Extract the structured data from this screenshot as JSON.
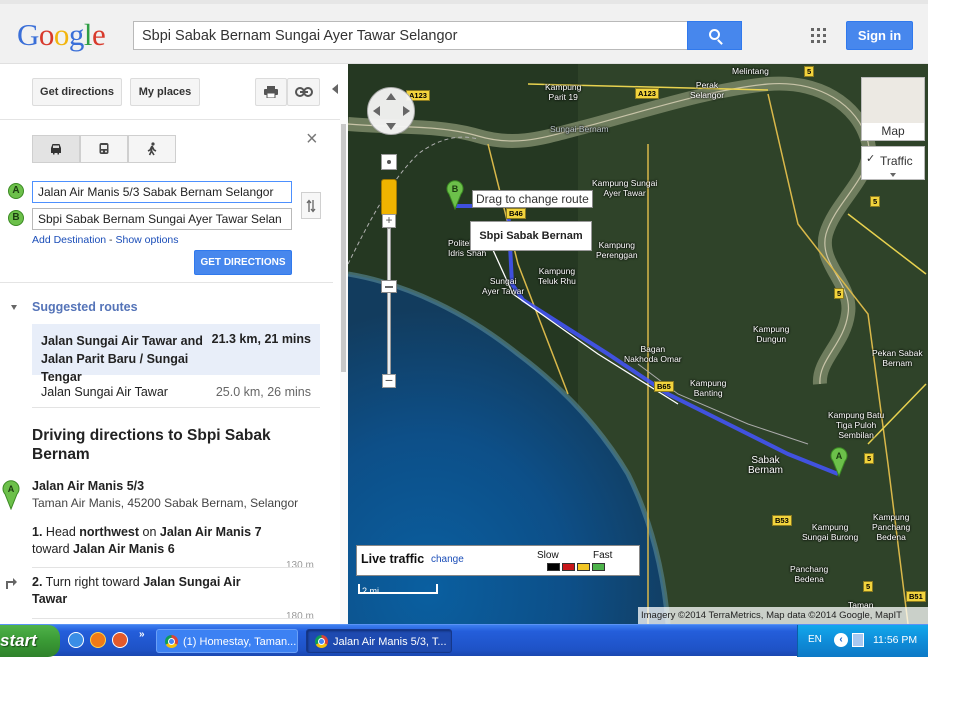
{
  "header": {
    "logo": "Google",
    "search_value": "Sbpi Sabak Bernam Sungai Ayer Tawar Selangor",
    "signin_label": "Sign in"
  },
  "panel": {
    "get_directions_tab": "Get directions",
    "my_places_tab": "My places",
    "origin_marker": "A",
    "dest_marker": "B",
    "origin_value": "Jalan Air Manis 5/3 Sabak Bernam Selangor",
    "destination_value": "Sbpi Sabak Bernam Sungai Ayer Tawar Selan",
    "add_destination": "Add Destination",
    "separator": " - ",
    "show_options": "Show options",
    "get_directions_button": "GET DIRECTIONS",
    "suggested_routes_title": "Suggested routes",
    "routes": [
      {
        "name": "Jalan Sungai Air Tawar and Jalan Parit Baru / Sungai Tengar",
        "distance": "21.3 km, 21 mins"
      },
      {
        "name": "Jalan Sungai Air Tawar",
        "distance": "25.0 km, 26 mins"
      }
    ],
    "driving_title": "Driving directions to Sbpi Sabak Bernam",
    "start_name": "Jalan Air Manis 5/3",
    "start_address": "Taman Air Manis, 45200 Sabak Bernam, Selangor",
    "steps": [
      {
        "num": "1.",
        "t1": " Head ",
        "b1": "northwest",
        "t2": " on ",
        "b2": "Jalan Air Manis 7",
        "t3": " toward ",
        "b3": "Jalan Air Manis 6",
        "distance": "130 m"
      },
      {
        "num": "2.",
        "t1": " Turn right toward ",
        "b1": "Jalan Sungai Air Tawar",
        "distance": "180 m"
      }
    ]
  },
  "map": {
    "labels": {
      "melintang": "Melintang",
      "kampung_parit19": "Kampung\nParit 19",
      "perak_selangor": "Perak\nSelangor",
      "sungai_bernam": "Sungai Bernam",
      "kampung_sungai_ayer_tawar": "Kampung Sungai\nAyer Tawar",
      "politeknik": "Politeknik\nIdris Shah",
      "kampung_perenggan": "Kampung\nPerenggan",
      "kampung_teluk_rhu": "Kampung\nTeluk Rhu",
      "sungai_ayer_tawar": "Sungai\nAyer Tawar",
      "kampung_dungun": "Kampung\nDungun",
      "pekan_sabak": "Pekan Sabak\nBernam",
      "bagan_nakhoda_omar": "Bagan\nNakhoda Omar",
      "kampung_banting": "Kampung\nBanting",
      "kampung_batu": "Kampung Batu\nTiga Puloh\nSembilan",
      "sabak_bernam": "Sabak\nBernam",
      "kampung_sungai_burong": "Kampung\nSungai Burong",
      "kampung_panchang_bedena": "Kampung\nPanchang\nBedena",
      "panchang_bedena": "Panchang\nBedena",
      "taman": "Taman"
    },
    "roads": {
      "a123a": "A123",
      "a123b": "A123",
      "r5a": "5",
      "r5b": "5",
      "r5c": "5",
      "r5d": "5",
      "r5e": "5",
      "b46": "B46",
      "b65": "B65",
      "b53": "B53",
      "b51": "B51"
    },
    "drag_tooltip": "Drag to change route",
    "place_label": "Sbpi Sabak Bernam",
    "map_type": "Map",
    "traffic_toggle": "Traffic",
    "live_traffic_title": "Live traffic",
    "live_traffic_change": "change",
    "slow_label": "Slow",
    "fast_label": "Fast",
    "traffic_colors": [
      "#000000",
      "#c8171a",
      "#f2c624",
      "#4db34a"
    ],
    "scale_label": "2 mi",
    "attribution": "Imagery ©2014 TerraMetrics, Map data ©2014 Google, MapIT",
    "route_color": "#4455ff"
  },
  "taskbar": {
    "start_label": "start",
    "quick_launch_more": "»",
    "task_1": "(1) Homestay, Taman...",
    "task_2": "Jalan Air Manis 5/3, T...",
    "language": "EN",
    "clock": "11:56 PM"
  }
}
